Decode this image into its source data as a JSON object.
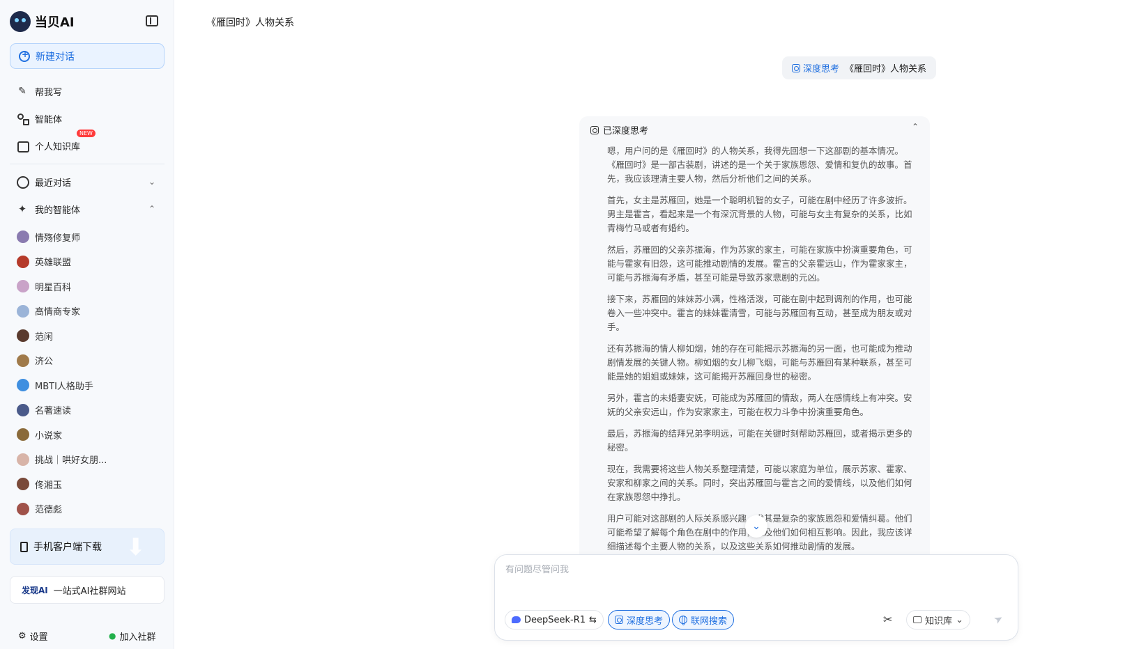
{
  "app": {
    "brand_name": "当贝AI",
    "new_chat_label": "新建对话"
  },
  "nav": {
    "help_write": "帮我写",
    "agents": "智能体",
    "personal_kb": "个人知识库",
    "new_badge": "NEW",
    "recent_chats": "最近对话",
    "my_agents": "我的智能体"
  },
  "agents": [
    {
      "name": "情殇修复师",
      "color": "#8a7bb0"
    },
    {
      "name": "英雄联盟",
      "color": "#b53a2a"
    },
    {
      "name": "明星百科",
      "color": "#c9a3c8"
    },
    {
      "name": "高情商专家",
      "color": "#9bb4d8"
    },
    {
      "name": "范闲",
      "color": "#5a3a2e"
    },
    {
      "name": "济公",
      "color": "#a07a4a"
    },
    {
      "name": "MBTI人格助手",
      "color": "#3f8fe0"
    },
    {
      "name": "名著速读",
      "color": "#4a5a8a"
    },
    {
      "name": "小说家",
      "color": "#8a6a3a"
    },
    {
      "name": "挑战｜哄好女朋...",
      "color": "#d8b4a8"
    },
    {
      "name": "佟湘玉",
      "color": "#7a4a3a"
    },
    {
      "name": "范德彪",
      "color": "#a0524a"
    }
  ],
  "download": {
    "label": "手机客户端下载"
  },
  "promo": {
    "logo_text": "发现AI",
    "label": "一站式AI社群网站"
  },
  "footer": {
    "settings": "设置",
    "join_group": "加入社群"
  },
  "main": {
    "page_title": "《雁回时》人物关系",
    "user_message": {
      "tag": "深度思考",
      "text": "《雁回时》人物关系"
    },
    "thinking": {
      "header": "已深度思考",
      "paragraphs": [
        "嗯，用户问的是《雁回时》的人物关系，我得先回想一下这部剧的基本情况。《雁回时》是一部古装剧，讲述的是一个关于家族恩怨、爱情和复仇的故事。首先，我应该理清主要人物，然后分析他们之间的关系。",
        "首先，女主是苏雁回，她是一个聪明机智的女子，可能在剧中经历了许多波折。男主是霍言，看起来是一个有深沉背景的人物，可能与女主有复杂的关系，比如青梅竹马或者有婚约。",
        "然后，苏雁回的父亲苏振海，作为苏家的家主，可能在家族中扮演重要角色，可能与霍家有旧怨，这可能推动剧情的发展。霍言的父亲霍远山，作为霍家家主，可能与苏振海有矛盾，甚至可能是导致苏家悲剧的元凶。",
        "接下来，苏雁回的妹妹苏小满，性格活泼，可能在剧中起到调剂的作用，也可能卷入一些冲突中。霍言的妹妹霍清雪，可能与苏雁回有互动，甚至成为朋友或对手。",
        "还有苏振海的情人柳如烟，她的存在可能揭示苏振海的另一面，也可能成为推动剧情发展的关键人物。柳如烟的女儿柳飞烟，可能与苏雁回有某种联系，甚至可能是她的姐姐或妹妹，这可能揭开苏雁回身世的秘密。",
        "另外，霍言的未婚妻安妩，可能成为苏雁回的情敌，两人在感情线上有冲突。安妩的父亲安远山，作为安家家主，可能在权力斗争中扮演重要角色。",
        "最后，苏振海的结拜兄弟李明远，可能在关键时刻帮助苏雁回，或者揭示更多的秘密。",
        "现在，我需要将这些人物关系整理清楚，可能以家庭为单位，展示苏家、霍家、安家和柳家之间的关系。同时，突出苏雁回与霍言之间的爱情线，以及他们如何在家族恩怨中挣扎。",
        "用户可能对这部剧的人际关系感兴趣，尤其是复杂的家族恩怨和爱情纠葛。他们可能希望了解每个角色在剧中的作用，以及他们如何相互影响。因此，我应该详细描述每个主要人物的关系，以及这些关系如何推动剧情的发展。"
      ]
    },
    "composer": {
      "placeholder": "有问题尽管问我",
      "model": "DeepSeek-R1",
      "model_switch": "⇆",
      "deep_think": "深度思考",
      "web_search": "联网搜索",
      "knowledge_base": "知识库"
    }
  }
}
